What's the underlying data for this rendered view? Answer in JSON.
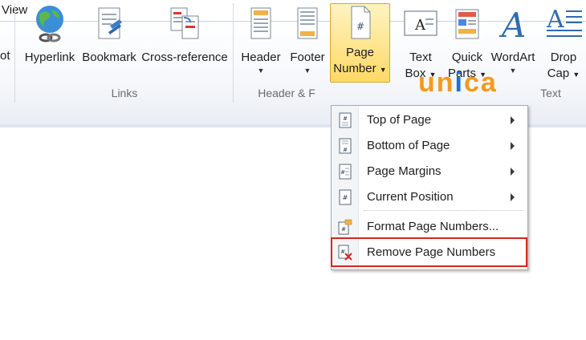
{
  "tabs": {
    "view": "View"
  },
  "ribbon": {
    "partial_label": "ot",
    "buttons": {
      "hyperlink": "Hyperlink",
      "bookmark": "Bookmark",
      "cross_reference": "Cross-reference",
      "header": "Header",
      "footer": "Footer",
      "page_number_line1": "Page",
      "page_number_line2": "Number",
      "text_box_line1": "Text",
      "text_box_line2": "Box",
      "quick_parts_line1": "Quick",
      "quick_parts_line2": "Parts",
      "wordart": "WordArt",
      "drop_cap_line1": "Drop",
      "drop_cap_line2": "Cap"
    },
    "groups": {
      "links": "Links",
      "header_footer": "Header & F",
      "text": "Text"
    }
  },
  "menu": {
    "items": [
      {
        "label": "Top of Page",
        "submenu": true
      },
      {
        "label": "Bottom of Page",
        "submenu": true
      },
      {
        "label": "Page Margins",
        "submenu": true
      },
      {
        "label": "Current Position",
        "submenu": true
      },
      {
        "label": "Format Page Numbers...",
        "submenu": false
      },
      {
        "label": "Remove Page Numbers",
        "submenu": false
      }
    ]
  },
  "watermark": {
    "text_a": "un",
    "text_b": "i",
    "text_c": "ca"
  },
  "colors": {
    "highlight": "#d9261c",
    "active_button": "#ffd965",
    "watermark_orange": "#f39a1c",
    "watermark_blue": "#1e6fd9"
  }
}
